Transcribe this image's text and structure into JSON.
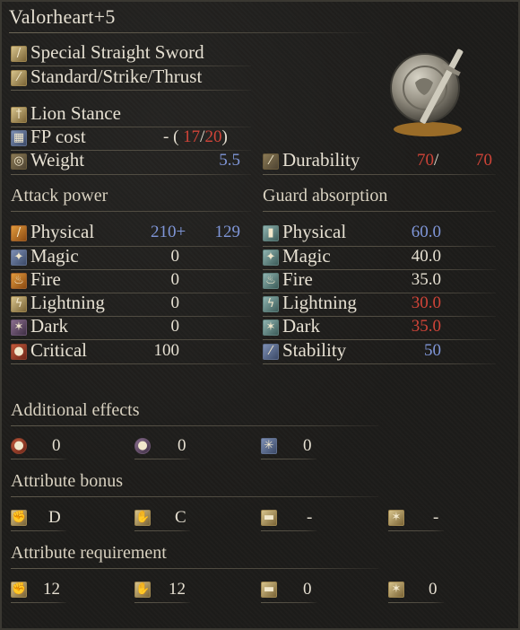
{
  "title": "Valorheart+5",
  "weapon_type": "Special Straight Sword",
  "attack_types": "Standard/Strike/Thrust",
  "skill": "Lion Stance",
  "fp_cost": {
    "label": "FP cost",
    "dash": "-",
    "open": "(",
    "current": "17",
    "sep": "/",
    "max": "20",
    "close": ")"
  },
  "weight": {
    "label": "Weight",
    "value": "5.5"
  },
  "durability": {
    "label": "Durability",
    "current": "70",
    "sep": "/",
    "max": "70"
  },
  "attack_power": {
    "header": "Attack power",
    "physical": {
      "label": "Physical",
      "base": "210",
      "plus": "+",
      "bonus": "129"
    },
    "magic": {
      "label": "Magic",
      "value": "0"
    },
    "fire": {
      "label": "Fire",
      "value": "0"
    },
    "lightning": {
      "label": "Lightning",
      "value": "0"
    },
    "dark": {
      "label": "Dark",
      "value": "0"
    },
    "critical": {
      "label": "Critical",
      "value": "100"
    }
  },
  "guard_absorption": {
    "header": "Guard absorption",
    "physical": {
      "label": "Physical",
      "value": "60.0"
    },
    "magic": {
      "label": "Magic",
      "value": "40.0"
    },
    "fire": {
      "label": "Fire",
      "value": "35.0"
    },
    "lightning": {
      "label": "Lightning",
      "value": "30.0"
    },
    "dark": {
      "label": "Dark",
      "value": "35.0"
    },
    "stability": {
      "label": "Stability",
      "value": "50"
    }
  },
  "additional_effects": {
    "header": "Additional effects",
    "bleed": "0",
    "poison": "0",
    "frost": "0"
  },
  "attribute_bonus": {
    "header": "Attribute bonus",
    "strength": "D",
    "dexterity": "C",
    "intelligence": "-",
    "faith": "-"
  },
  "attribute_requirement": {
    "header": "Attribute requirement",
    "strength": "12",
    "dexterity": "12",
    "intelligence": "0",
    "faith": "0"
  },
  "colors": {
    "blue": "#7f96d8",
    "red": "#d04438",
    "text": "#e6e0d2"
  }
}
